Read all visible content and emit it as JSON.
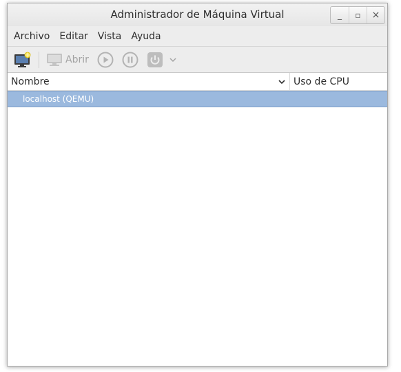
{
  "window": {
    "title": "Administrador de Máquina Virtual",
    "controls": {
      "minimize": "_",
      "maximize": "▫",
      "close": "×"
    }
  },
  "menubar": {
    "items": [
      {
        "label": "Archivo"
      },
      {
        "label": "Editar"
      },
      {
        "label": "Vista"
      },
      {
        "label": "Ayuda"
      }
    ]
  },
  "toolbar": {
    "new_icon": "new-vm-icon",
    "open_label": "Abrir",
    "open_icon": "monitor-icon",
    "run_icon": "play-icon",
    "pause_icon": "pause-icon",
    "shutdown_icon": "power-icon",
    "dropdown_icon": "chevron-down-icon"
  },
  "columns": {
    "name_label": "Nombre",
    "cpu_label": "Uso de CPU"
  },
  "list": {
    "rows": [
      {
        "label": "localhost (QEMU)",
        "selected": true
      }
    ]
  },
  "colors": {
    "selection": "#9bb9de",
    "disabled": "#a3a3a3"
  }
}
